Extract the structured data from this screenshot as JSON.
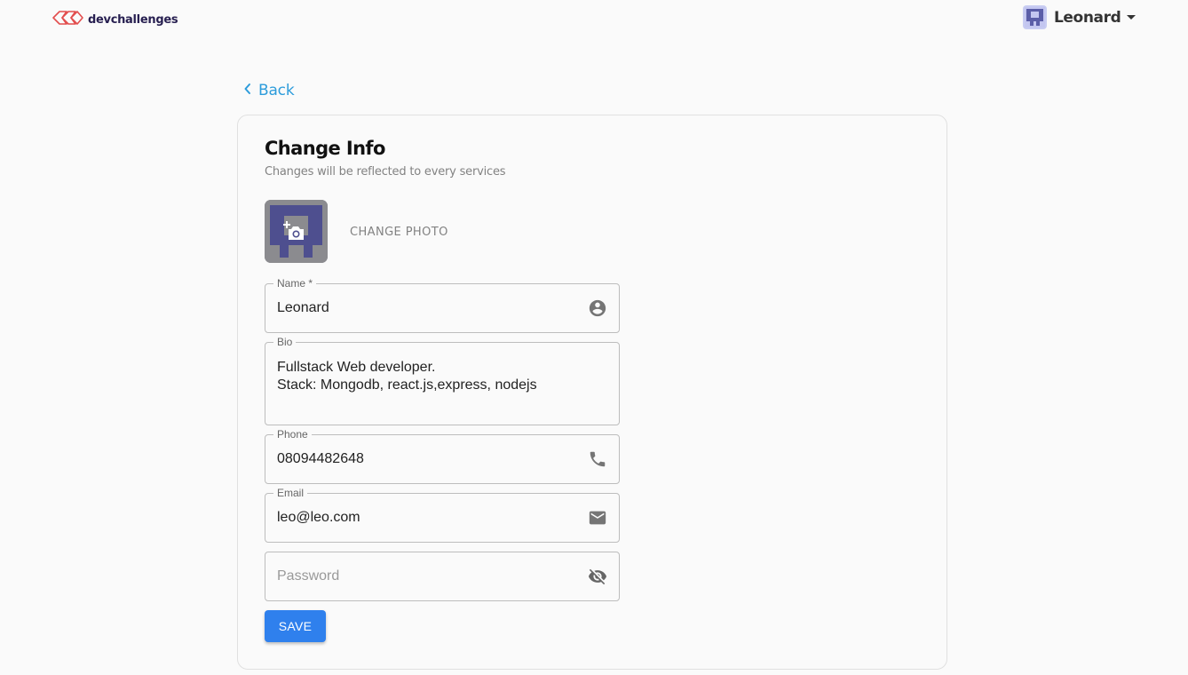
{
  "header": {
    "logo_text": "devchallenges",
    "logo_icon": "devchallenges-logo-icon",
    "user": {
      "name": "Leonard",
      "avatar_icon": "avatar-icon",
      "menu_icon": "caret-down-icon"
    }
  },
  "nav": {
    "back_label": "Back",
    "back_icon": "chevron-left-icon"
  },
  "card": {
    "title": "Change Info",
    "subtitle": "Changes will be reflected to every services",
    "change_photo_label": "CHANGE PHOTO",
    "photo_icon": "add-photo-icon"
  },
  "form": {
    "name": {
      "label": "Name *",
      "value": "Leonard",
      "icon": "account-circle-icon"
    },
    "bio": {
      "label": "Bio",
      "value": "Fullstack Web developer.\nStack: Mongodb, react.js,express, nodejs"
    },
    "phone": {
      "label": "Phone",
      "value": "08094482648",
      "icon": "phone-icon"
    },
    "email": {
      "label": "Email",
      "value": "leo@leo.com",
      "icon": "mail-icon"
    },
    "password": {
      "placeholder": "Password",
      "value": "",
      "icon": "visibility-off-icon"
    },
    "save_label": "SAVE"
  },
  "colors": {
    "accent": "#2F80ED",
    "link": "#2D9CDB",
    "avatar_bg": "#4E4F8F"
  }
}
